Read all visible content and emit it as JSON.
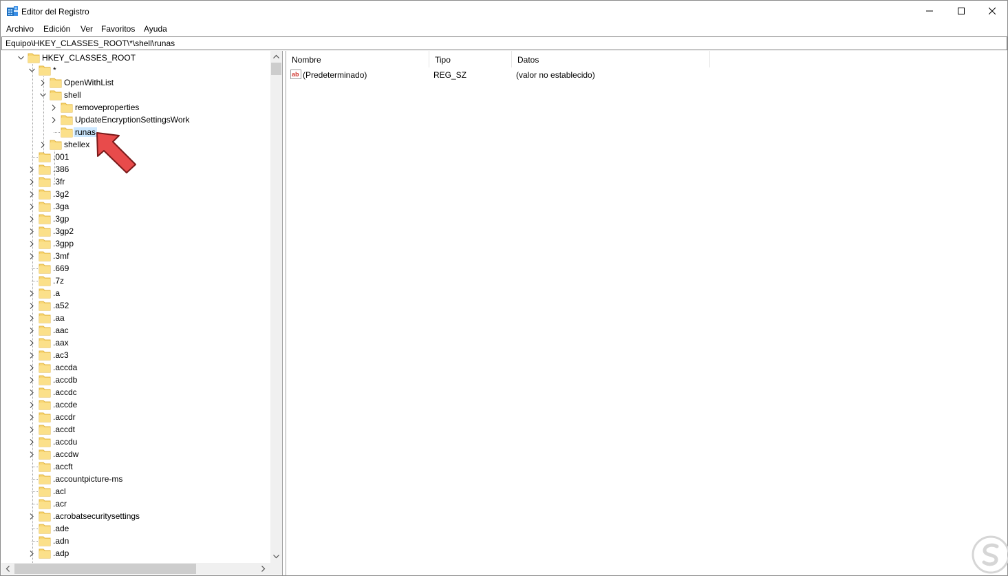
{
  "window": {
    "title": "Editor del Registro",
    "controls": [
      "minimize",
      "maximize",
      "close"
    ]
  },
  "menu": [
    "Archivo",
    "Edición",
    "Ver",
    "Favoritos",
    "Ayuda"
  ],
  "address": "Equipo\\HKEY_CLASSES_ROOT\\*\\shell\\runas",
  "tree": {
    "root": "HKEY_CLASSES_ROOT",
    "star": "*",
    "star_children": [
      "OpenWithList",
      "shell",
      "shellex"
    ],
    "shell_children": [
      "removeproperties",
      "UpdateEncryptionSettingsWork",
      "runas"
    ],
    "selected": "runas",
    "extensions": [
      ".001",
      ".386",
      ".3fr",
      ".3g2",
      ".3ga",
      ".3gp",
      ".3gp2",
      ".3gpp",
      ".3mf",
      ".669",
      ".7z",
      ".a",
      ".a52",
      ".aa",
      ".aac",
      ".aax",
      ".ac3",
      ".accda",
      ".accdb",
      ".accdc",
      ".accde",
      ".accdr",
      ".accdt",
      ".accdu",
      ".accdw",
      ".accft",
      ".accountpicture-ms",
      ".acl",
      ".acr",
      ".acrobatsecuritysettings",
      ".ade",
      ".adn",
      ".adp"
    ]
  },
  "list": {
    "columns": [
      "Nombre",
      "Tipo",
      "Datos"
    ],
    "rows": [
      {
        "name": "(Predeterminado)",
        "type": "REG_SZ",
        "data": "(valor no establecido)"
      }
    ]
  },
  "colors": {
    "folder": "#f8d775",
    "selection": "#cce8ff",
    "arrow": "#e84b4b"
  },
  "icons": [
    "registry-editor-icon",
    "folder-icon",
    "string-value-icon",
    "pointer-arrow-icon",
    "watermark-logo"
  ]
}
